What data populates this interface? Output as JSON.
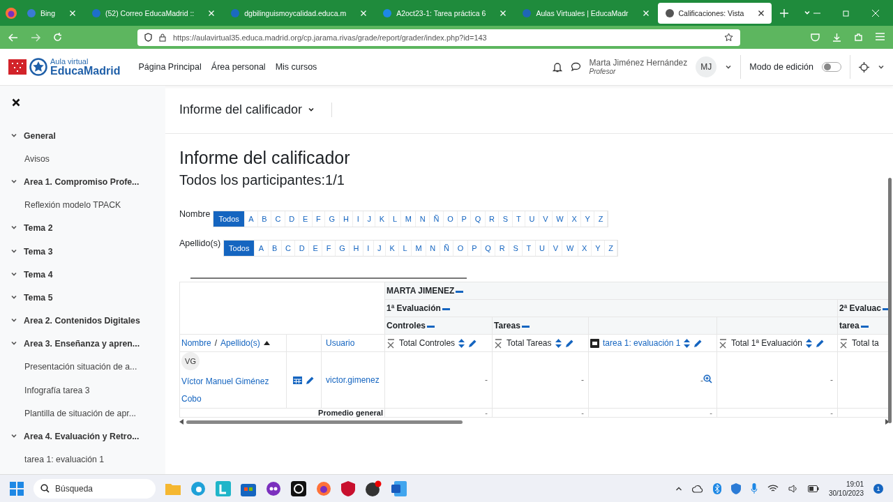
{
  "browser": {
    "tabs": [
      {
        "title": "Bing",
        "selected": false
      },
      {
        "title": "(52) Correo EducaMadrid ::",
        "selected": false
      },
      {
        "title": "dgbilinguismoycalidad.educa.m",
        "selected": false
      },
      {
        "title": "A2oct23-1: Tarea práctica 6",
        "selected": false
      },
      {
        "title": "Aulas Virtuales | EducaMadr",
        "selected": false
      },
      {
        "title": "Calificaciones: Vista",
        "selected": true
      }
    ],
    "url": "https://aulavirtual35.educa.madrid.org/cp.jarama.rivas/grade/report/grader/index.php?id=143"
  },
  "header": {
    "logo_top": "Aula virtual",
    "logo_bottom": "EducaMadrid",
    "nav": [
      "Página Principal",
      "Área personal",
      "Mis cursos"
    ],
    "user_name": "Marta Jiménez Hernández",
    "user_role": "Profesor",
    "initials": "MJ",
    "edit_mode_label": "Modo de edición",
    "edit_mode_on": false
  },
  "sidebar": {
    "items": [
      {
        "label": "General",
        "kind": "section",
        "expanded": true
      },
      {
        "label": "Avisos",
        "kind": "activity"
      },
      {
        "label": "Area 1. Compromiso Profe...",
        "kind": "section",
        "expanded": true
      },
      {
        "label": "Reflexión modelo TPACK",
        "kind": "activity"
      },
      {
        "label": "Tema 2",
        "kind": "section",
        "expanded": true
      },
      {
        "label": "Tema 3",
        "kind": "section",
        "expanded": true
      },
      {
        "label": "Tema 4",
        "kind": "section",
        "expanded": true
      },
      {
        "label": "Tema 5",
        "kind": "section",
        "expanded": true
      },
      {
        "label": "Area 2. Contenidos Digitales",
        "kind": "section",
        "expanded": true
      },
      {
        "label": "Area 3. Enseñanza y apren...",
        "kind": "section",
        "expanded": true
      },
      {
        "label": "Presentación situación de a...",
        "kind": "activity"
      },
      {
        "label": "Infografía tarea 3",
        "kind": "activity"
      },
      {
        "label": "Plantilla de situación de apr...",
        "kind": "activity"
      },
      {
        "label": "Area 4. Evaluación y Retro...",
        "kind": "section",
        "expanded": true
      },
      {
        "label": "tarea 1: evaluación 1",
        "kind": "activity"
      }
    ]
  },
  "page": {
    "menu_title": "Informe del calificador",
    "title": "Informe del calificador",
    "subtitle": "Todos los participantes:1/1",
    "filters": [
      {
        "label": "Nombre",
        "letters": [
          {
            "label": "Todos",
            "selected": true
          },
          {
            "label": "A",
            "selected": false
          },
          {
            "label": "B",
            "selected": false
          },
          {
            "label": "C",
            "selected": false
          },
          {
            "label": "D",
            "selected": false
          },
          {
            "label": "E",
            "selected": false
          },
          {
            "label": "F",
            "selected": false
          },
          {
            "label": "G",
            "selected": false
          },
          {
            "label": "H",
            "selected": false
          },
          {
            "label": "I",
            "selected": false
          },
          {
            "label": "J",
            "selected": false
          },
          {
            "label": "K",
            "selected": false
          },
          {
            "label": "L",
            "selected": false
          },
          {
            "label": "M",
            "selected": false
          },
          {
            "label": "N",
            "selected": false
          },
          {
            "label": "Ñ",
            "selected": false
          },
          {
            "label": "O",
            "selected": false
          },
          {
            "label": "P",
            "selected": false
          },
          {
            "label": "Q",
            "selected": false
          },
          {
            "label": "R",
            "selected": false
          },
          {
            "label": "S",
            "selected": false
          },
          {
            "label": "T",
            "selected": false
          },
          {
            "label": "U",
            "selected": false
          },
          {
            "label": "V",
            "selected": false
          },
          {
            "label": "W",
            "selected": false
          },
          {
            "label": "X",
            "selected": false
          },
          {
            "label": "Y",
            "selected": false
          },
          {
            "label": "Z",
            "selected": false
          }
        ]
      },
      {
        "label": "Apellido(s)",
        "letters": [
          {
            "label": "Todos",
            "selected": true
          },
          {
            "label": "A",
            "selected": false
          },
          {
            "label": "B",
            "selected": false
          },
          {
            "label": "C",
            "selected": false
          },
          {
            "label": "D",
            "selected": false
          },
          {
            "label": "E",
            "selected": false
          },
          {
            "label": "F",
            "selected": false
          },
          {
            "label": "G",
            "selected": false
          },
          {
            "label": "H",
            "selected": false
          },
          {
            "label": "I",
            "selected": false
          },
          {
            "label": "J",
            "selected": false
          },
          {
            "label": "K",
            "selected": false
          },
          {
            "label": "L",
            "selected": false
          },
          {
            "label": "M",
            "selected": false
          },
          {
            "label": "N",
            "selected": false
          },
          {
            "label": "Ñ",
            "selected": false
          },
          {
            "label": "O",
            "selected": false
          },
          {
            "label": "P",
            "selected": false
          },
          {
            "label": "Q",
            "selected": false
          },
          {
            "label": "R",
            "selected": false
          },
          {
            "label": "S",
            "selected": false
          },
          {
            "label": "T",
            "selected": false
          },
          {
            "label": "U",
            "selected": false
          },
          {
            "label": "V",
            "selected": false
          },
          {
            "label": "W",
            "selected": false
          },
          {
            "label": "X",
            "selected": false
          },
          {
            "label": "Y",
            "selected": false
          },
          {
            "label": "Z",
            "selected": false
          }
        ]
      }
    ]
  },
  "grader": {
    "category_rows": [
      [
        {
          "kind": "category",
          "label": "MARTA JIMENEZ"
        }
      ],
      [
        {
          "kind": "category",
          "label": "1ª Evaluación"
        },
        {
          "kind": "category",
          "label": "2ª Evaluac"
        }
      ],
      [
        {
          "kind": "category",
          "label": "Controles"
        },
        {
          "kind": "category",
          "label": "Tareas"
        },
        {
          "kind": "empty"
        },
        {
          "kind": "empty"
        },
        {
          "kind": "category",
          "label": "tarea"
        }
      ]
    ],
    "name_header": {
      "first": "Nombre",
      "separator": "/",
      "last": "Apellido(s)"
    },
    "user_header": "Usuario",
    "columns": [
      {
        "label": "Total Controles",
        "kind": "total"
      },
      {
        "label": "Total Tareas",
        "kind": "total"
      },
      {
        "label": "tarea 1: evaluación 1",
        "kind": "activity"
      },
      {
        "label": "Total 1ª Evaluación",
        "kind": "total"
      },
      {
        "label": "Total ta",
        "kind": "total_cut"
      }
    ],
    "rows": [
      {
        "initials": "VG",
        "name": "Víctor Manuel Giménez Cobo",
        "username": "victor.gimenez",
        "grades": [
          "-",
          "-",
          "-",
          "-"
        ]
      }
    ],
    "average": {
      "label": "Promedio general",
      "grades": [
        "-",
        "-",
        "-",
        "-"
      ]
    }
  },
  "taskbar": {
    "search_placeholder": "Búsqueda",
    "time": "19:01",
    "date": "30/10/2023",
    "notifications": "1"
  }
}
